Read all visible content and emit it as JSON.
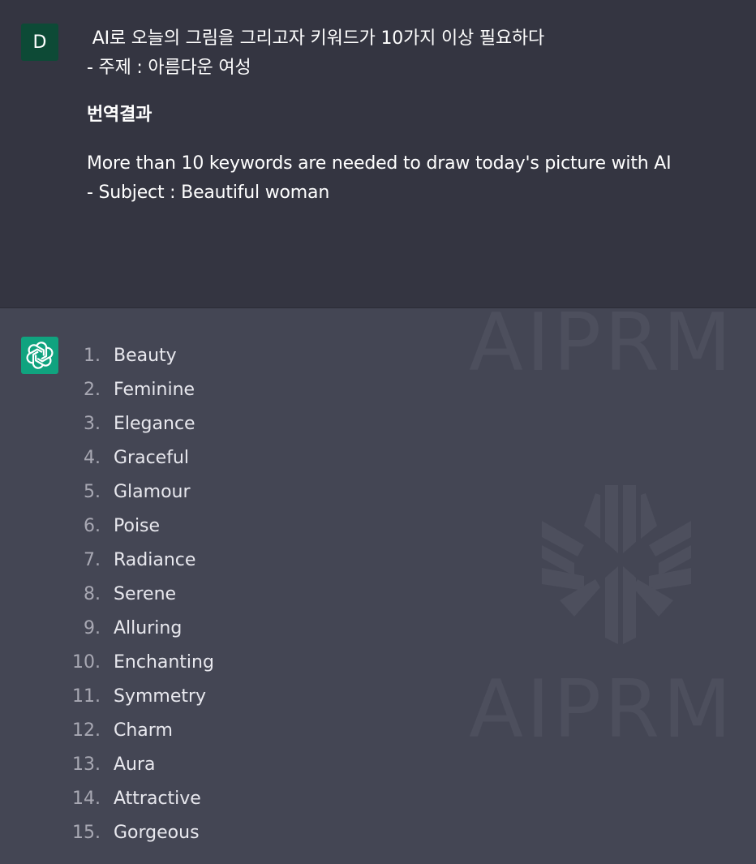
{
  "user_message": {
    "avatar_letter": "D",
    "line1": " AI로 오늘의 그림을 그리고자 키워드가 10가지 이상 필요하다",
    "line2": "- 주제 : 아름다운 여성",
    "translation_heading": "번역결과",
    "translation_line1": "More than 10 keywords are needed to draw today's picture with AI",
    "translation_line2": "- Subject : Beautiful woman"
  },
  "assistant_message": {
    "avatar_icon": "openai-logo-icon",
    "keywords": [
      {
        "num": "1.",
        "word": "Beauty"
      },
      {
        "num": "2.",
        "word": "Feminine"
      },
      {
        "num": "3.",
        "word": "Elegance"
      },
      {
        "num": "4.",
        "word": "Graceful"
      },
      {
        "num": "5.",
        "word": "Glamour"
      },
      {
        "num": "6.",
        "word": "Poise"
      },
      {
        "num": "7.",
        "word": "Radiance"
      },
      {
        "num": "8.",
        "word": "Serene"
      },
      {
        "num": "9.",
        "word": "Alluring"
      },
      {
        "num": "10.",
        "word": "Enchanting"
      },
      {
        "num": "11.",
        "word": "Symmetry"
      },
      {
        "num": "12.",
        "word": "Charm"
      },
      {
        "num": "13.",
        "word": "Aura"
      },
      {
        "num": "14.",
        "word": "Attractive"
      },
      {
        "num": "15.",
        "word": "Gorgeous"
      }
    ]
  },
  "watermark": {
    "text_top": "AIPRM",
    "text_bottom": "AIPRM"
  },
  "colors": {
    "user_bg": "#343541",
    "assistant_bg": "#444654",
    "user_avatar_bg": "#0d4a36",
    "bot_avatar_bg": "#10a37f"
  }
}
